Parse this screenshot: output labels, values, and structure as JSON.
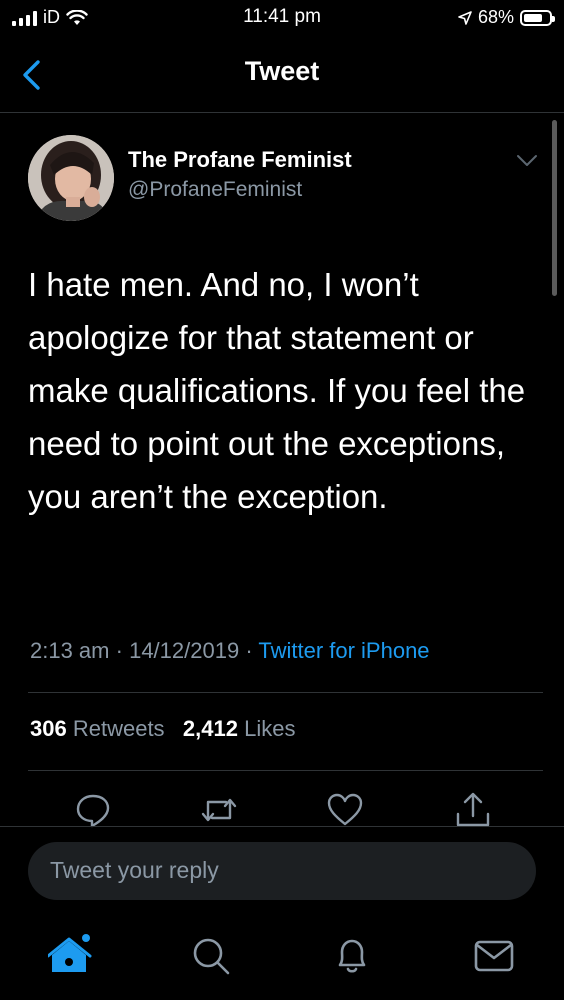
{
  "status_bar": {
    "carrier": "iD",
    "time": "11:41 pm",
    "battery": "68%",
    "battery_level": 0.68
  },
  "header": {
    "title": "Tweet",
    "back_icon": "chevron-left-icon"
  },
  "tweet": {
    "display_name": "The Profane Feminist",
    "handle": "@ProfaneFeminist",
    "text": "I hate men. And no, I won’t apologize for that statement or make qualifications. If you feel the need to point out the exceptions, you aren’t the exception.",
    "time": "2:13 am",
    "date": "14/12/2019",
    "source": "Twitter for iPhone",
    "retweets_count": "306",
    "retweets_label": "Retweets",
    "likes_count": "2,412",
    "likes_label": "Likes"
  },
  "actions": [
    "reply-icon",
    "retweet-icon",
    "like-icon",
    "share-icon"
  ],
  "reply": {
    "placeholder": "Tweet your reply"
  },
  "tabbar": [
    "home-icon",
    "search-icon",
    "notifications-icon",
    "messages-icon"
  ],
  "colors": {
    "accent": "#1d9bf0",
    "secondary_text": "#8b98a5",
    "background": "#000000",
    "divider": "#2f3336"
  }
}
